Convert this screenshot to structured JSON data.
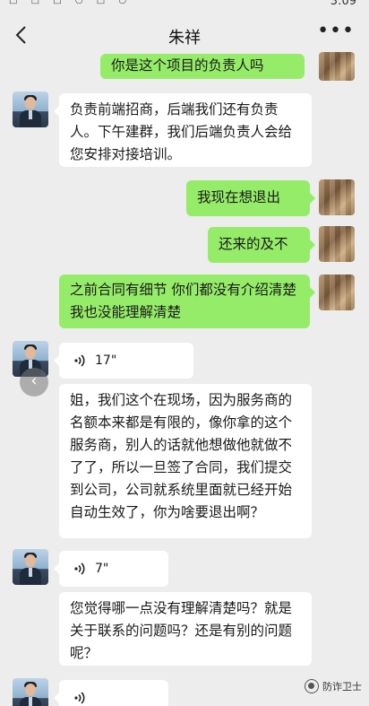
{
  "status": {
    "time": "3:09",
    "icons": "□ □ □ ○ □ ○"
  },
  "nav": {
    "title": "朱祥",
    "more": "•••"
  },
  "messages": [
    {
      "side": "right",
      "type": "text",
      "text": "你是这个项目的负责人吗"
    },
    {
      "side": "left",
      "type": "text",
      "text": "负责前端招商，后端我们还有负责人。下午建群，我们后端负责人会给您安排对接培训。"
    },
    {
      "side": "right",
      "type": "text",
      "text": "我现在想退出"
    },
    {
      "side": "right",
      "type": "text",
      "text": "还来的及不"
    },
    {
      "side": "right",
      "type": "text",
      "text": "之前合同有细节 你们都没有介绍清楚  我也没能理解清楚"
    },
    {
      "side": "left",
      "type": "voice",
      "duration": "17\""
    },
    {
      "side": "left",
      "type": "text",
      "text": "姐，我们这个在现场，因为服务商的名额本来都是有限的，像你拿的这个服务商，别人的话就他想做他就做不了了，所以一旦签了合同，我们提交到公司，公司就系统里面就已经开始自动生效了，你为啥要退出啊？"
    },
    {
      "side": "left",
      "type": "voice",
      "duration": "7\""
    },
    {
      "side": "left",
      "type": "text",
      "text": "您觉得哪一点没有理解清楚吗？就是关于联系的问题吗？还是有别的问题呢？"
    },
    {
      "side": "left",
      "type": "voice",
      "duration": ""
    }
  ],
  "watermark": {
    "text": "防诈卫士"
  },
  "colors": {
    "background": "#ededed",
    "sent_bubble": "#95ec69",
    "received_bubble": "#ffffff"
  }
}
